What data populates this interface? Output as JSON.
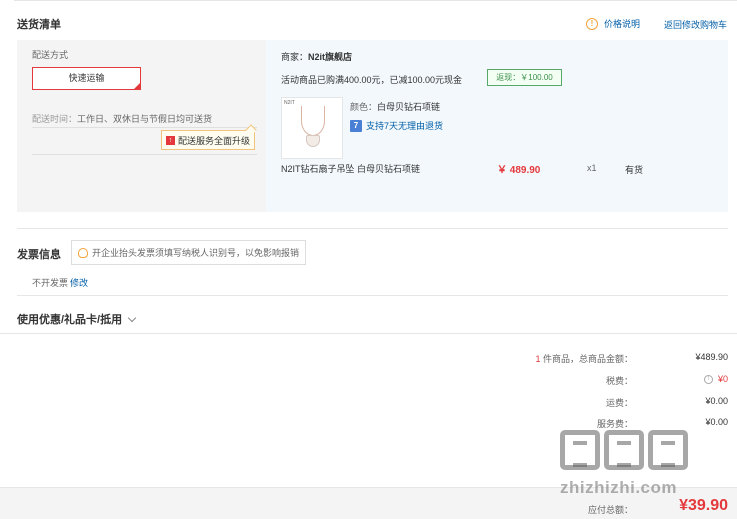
{
  "header": {
    "title": "送货清单",
    "price_help": "价格说明",
    "price_help_icon": "info-circle-icon",
    "back_to_cart": "返回修改购物车"
  },
  "shipping": {
    "method_label": "配送方式",
    "method_value": "快速运输",
    "time_label": "配送时间：",
    "time_value": "工作日、双休日与节假日均可送货",
    "upgrade_tip": "配送服务全面升级"
  },
  "order": {
    "merchant_label": "商家：",
    "merchant_name": "N2it旗舰店",
    "promo": "活动商品已购满400.00元，已减100.00元现金",
    "rebate": "返现：￥100.00",
    "thumb_brand": "N2IT",
    "color_label": "颜色：",
    "color_value": "白母贝钻石项链",
    "return_policy": "支持7天无理由退货",
    "return_icon_char": "7",
    "product_name": "N2IT钻石扇子吊坠 白母贝钻石项链",
    "price": "￥ 489.90",
    "qty": "x1",
    "stock": "有货"
  },
  "invoice": {
    "title": "发票信息",
    "tip": "开企业抬头发票须填写纳税人识别号，以免影响报销",
    "none_text": "不开发票",
    "edit_link": "修改"
  },
  "coupon": {
    "title": "使用优惠/礼品卡/抵用"
  },
  "summary": {
    "count": "1",
    "count_suffix": " 件商品，总商品金额：",
    "total_goods": "¥489.90",
    "tax_label": "税费：",
    "tax_value": "¥0",
    "freight_label": "运费：",
    "freight_value": "¥0.00",
    "service_label": "服务费：",
    "service_value": "¥0.00",
    "payable_label": "应付总额：",
    "payable_value": "¥39.90"
  },
  "watermark": {
    "text": "zhizhizhi.com"
  },
  "colors": {
    "accent_red": "#e4393c",
    "link_blue": "#005ea7",
    "rebate_green": "#3c8f4d",
    "panel_grey": "#f4f4f4",
    "panel_blue": "#f3f8fc"
  }
}
